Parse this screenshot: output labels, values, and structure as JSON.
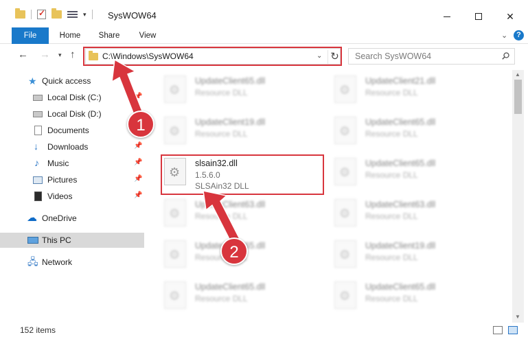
{
  "window": {
    "title": "SysWOW64",
    "minimize": "minimize",
    "maximize": "maximize",
    "close": "✕"
  },
  "ribbon": {
    "tabs": [
      "File",
      "Home",
      "Share",
      "View"
    ]
  },
  "address": {
    "path": "C:\\Windows\\SysWOW64",
    "search_placeholder": "Search SysWOW64"
  },
  "nav_pane": {
    "items": [
      {
        "label": "Quick access",
        "icon": "star-icon",
        "pinned": false
      },
      {
        "label": "Local Disk (C:)",
        "icon": "drive-icon",
        "pinned": true
      },
      {
        "label": "Local Disk (D:)",
        "icon": "drive-icon",
        "pinned": false
      },
      {
        "label": "Documents",
        "icon": "documents-icon",
        "pinned": false
      },
      {
        "label": "Downloads",
        "icon": "download-icon",
        "pinned": true
      },
      {
        "label": "Music",
        "icon": "music-icon",
        "pinned": true
      },
      {
        "label": "Pictures",
        "icon": "pictures-icon",
        "pinned": true
      },
      {
        "label": "Videos",
        "icon": "videos-icon",
        "pinned": true
      },
      {
        "label": "OneDrive",
        "icon": "cloud-icon",
        "pinned": false
      },
      {
        "label": "This PC",
        "icon": "computer-icon",
        "pinned": false,
        "selected": true
      },
      {
        "label": "Network",
        "icon": "network-icon",
        "pinned": false
      }
    ]
  },
  "files": {
    "left_column": [
      {
        "name": "UpdateClient65.dll",
        "type": "Resource DLL"
      },
      {
        "name": "UpdateClient19.dll",
        "type": "Resource DLL"
      },
      {
        "name": "slsain32.dll",
        "version": "1.5.6.0",
        "type": "SLSAin32 DLL",
        "highlighted": true
      },
      {
        "name": "UpdateClient63.dll",
        "type": "Resource DLL"
      },
      {
        "name": "UpdateClient65.dll",
        "type": "Resource DLL"
      },
      {
        "name": "UpdateClient65.dll",
        "type": "Resource DLL"
      }
    ],
    "right_column": [
      {
        "name": "UpdateClient21.dll",
        "type": "Resource DLL"
      },
      {
        "name": "UpdateClient65.dll",
        "type": "Resource DLL"
      },
      {
        "name": "UpdateClient65.dll",
        "type": "Resource DLL"
      },
      {
        "name": "UpdateClient63.dll",
        "type": "Resource DLL"
      },
      {
        "name": "UpdateClient19.dll",
        "type": "Resource DLL"
      },
      {
        "name": "UpdateClient65.dll",
        "type": "Resource DLL"
      }
    ]
  },
  "status": {
    "item_count": "152 items"
  },
  "annotations": {
    "step1": "1",
    "step2": "2",
    "color": "#d8353d"
  }
}
